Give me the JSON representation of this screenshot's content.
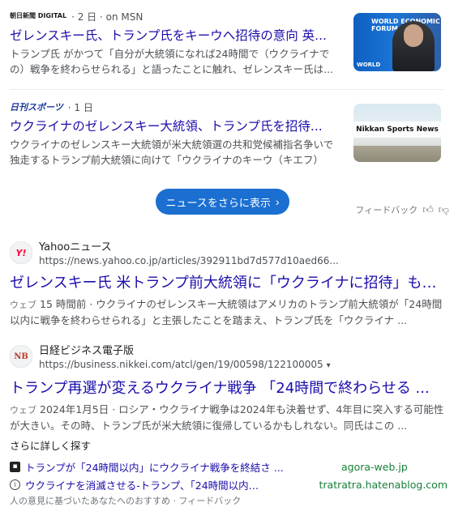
{
  "news": [
    {
      "source_logo": "朝日新聞 DIGITAL",
      "meta": "· 2 日 · on MSN",
      "title": "ゼレンスキー氏、トランプ氏をキーウへ招待の意向 英...",
      "snippet": "トランプ氏 がかつて「自分が大統領になれば24時間で（ウクライナでの）戦争を終わらせられる」と語ったことに触れ、ゼレンスキー氏は...",
      "thumb_text": "WORLD ECONOMIC FORUM",
      "thumb_logo": "WORLD"
    },
    {
      "source_logo": "日刊スポーツ",
      "meta": "· 1 日",
      "title": "ウクライナのゼレンスキー大統領、トランプ氏を招待...",
      "snippet": "ウクライナのゼレンスキー大統領が米大統領選の共和党候補指名争いで独走するトランプ前大統領に向けて「ウクライナのキーウ（キエフ）に...",
      "thumb_text": "Nikkan Sports News"
    }
  ],
  "more_news_button": "ニュースをさらに表示",
  "feedback_label": "フィードバック",
  "results": [
    {
      "favicon": "Y!",
      "site_name": "Yahooニュース",
      "url": "https://news.yahoo.co.jp/articles/392911bd7d577d10aed66...",
      "title": "ゼレンスキー氏 米トランプ前大統領に「ウクライナに招待」も ...",
      "tag": "ウェブ",
      "snippet": "15 時間前 · ウクライナのゼレンスキー大統領はアメリカのトランプ前大統領が「24時間以内に戦争を終わらせられる」と主張したことを踏まえ、トランプ氏を「ウクライナ ..."
    },
    {
      "favicon": "NB",
      "site_name": "日経ビジネス電子版",
      "url": "https://business.nikkei.com/atcl/gen/19/00598/122100005",
      "title": "トランプ再選が変えるウクライナ戦争 「24時間で終わらせる ...",
      "tag": "ウェブ",
      "snippet": "2024年1月5日 · ロシア・ウクライナ戦争は2024年も決着せず、4年目に突入する可能性が大きい。その時、トランプ氏が米大統領に復帰しているかもしれない。同氏はこの ..."
    }
  ],
  "explore": {
    "label": "さらに詳しく探す",
    "items": [
      {
        "title": "トランプが「24時間以内」にウクライナ戦争を終結さ ...",
        "domain": "agora-web.jp"
      },
      {
        "title": "ウクライナを消滅させる-トランプ、「24時間以内に ...",
        "domain": "tratratra.hatenablog.com"
      }
    ]
  },
  "footer_partial": "人の意見に基づいたあなたへのおすすめ · フィードバック"
}
